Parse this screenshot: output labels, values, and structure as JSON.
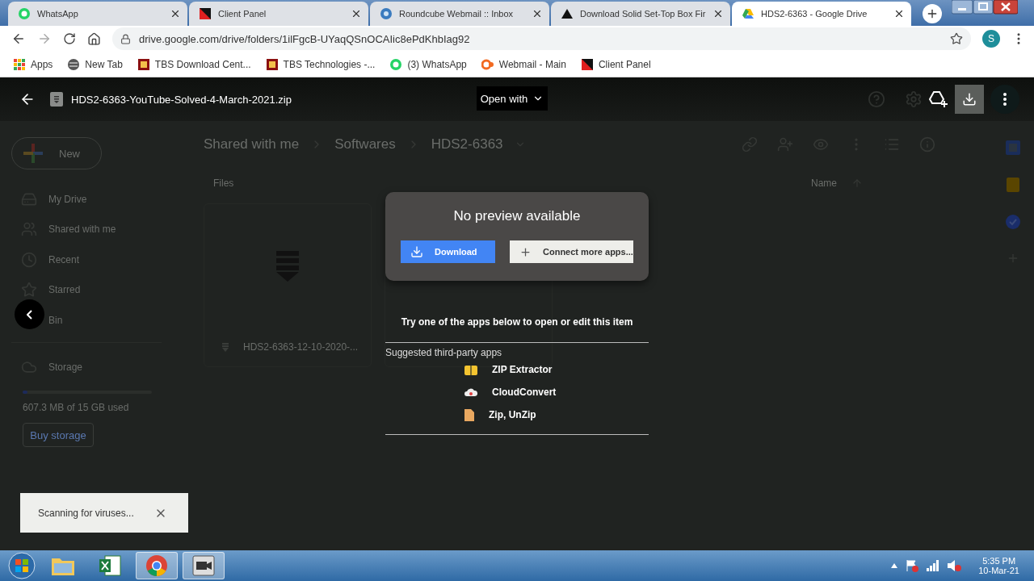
{
  "browser": {
    "tabs": [
      {
        "title": "WhatsApp",
        "kind": "whatsapp",
        "selected": false
      },
      {
        "title": "Client Panel",
        "kind": "panel",
        "selected": false
      },
      {
        "title": "Roundcube Webmail :: Inbox",
        "kind": "roundcube",
        "selected": false
      },
      {
        "title": "Download Solid Set-Top Box Fir",
        "kind": "solid",
        "selected": false
      },
      {
        "title": "HDS2-6363 - Google Drive",
        "kind": "drive",
        "selected": true
      }
    ],
    "address": "drive.google.com/drive/folders/1ilFgcB-UYaqQSnOCAIic8ePdKhbIag92",
    "profile": "S",
    "bookmarks": [
      {
        "label": "Apps",
        "kind": "apps"
      },
      {
        "label": "New Tab",
        "kind": "globe"
      },
      {
        "label": "TBS Download Cent...",
        "kind": "tbs"
      },
      {
        "label": "TBS Technologies -...",
        "kind": "tbs"
      },
      {
        "label": "(3) WhatsApp",
        "kind": "whatsapp"
      },
      {
        "label": "Webmail - Main",
        "kind": "cpanel"
      },
      {
        "label": "Client Panel",
        "kind": "panel"
      }
    ]
  },
  "drive": {
    "new_button": "New",
    "sidebar": [
      {
        "label": "My Drive",
        "kind": "drive"
      },
      {
        "label": "Shared with me",
        "kind": "shared"
      },
      {
        "label": "Recent",
        "kind": "recent"
      },
      {
        "label": "Starred",
        "kind": "starred"
      },
      {
        "label": "Bin",
        "kind": "bin"
      }
    ],
    "storage": {
      "label": "Storage",
      "usage": "607.3 MB of 15 GB used",
      "level": 0.04,
      "buy": "Buy storage"
    },
    "breadcrumbs": [
      "Shared with me",
      "Softwares",
      "HDS2-6363"
    ],
    "section": "Files",
    "sort_column": "Name",
    "files": [
      {
        "name": "HDS2-6363-12-10-2020-..."
      }
    ]
  },
  "viewer": {
    "file_name": "HDS2-6363-YouTube-Solved-4-March-2021.zip",
    "open_with": "Open with",
    "dialog": {
      "title": "No preview available",
      "download": "Download",
      "connect": "Connect more apps..."
    },
    "hint": "Try one of the apps below to open or edit this item",
    "suggested_title": "Suggested third-party apps",
    "apps": [
      {
        "name": "ZIP Extractor",
        "kind": "zip"
      },
      {
        "name": "CloudConvert",
        "kind": "cloud"
      },
      {
        "name": "Zip, UnZip",
        "kind": "file"
      }
    ],
    "toast": "Scanning for viruses..."
  },
  "taskbar": {
    "apps": [
      {
        "kind": "explorer",
        "running": false
      },
      {
        "kind": "excel",
        "running": false
      },
      {
        "kind": "chrome",
        "running": true
      },
      {
        "kind": "recorder",
        "running": true
      }
    ],
    "time": "5:35 PM",
    "date": "10-Mar-21"
  }
}
